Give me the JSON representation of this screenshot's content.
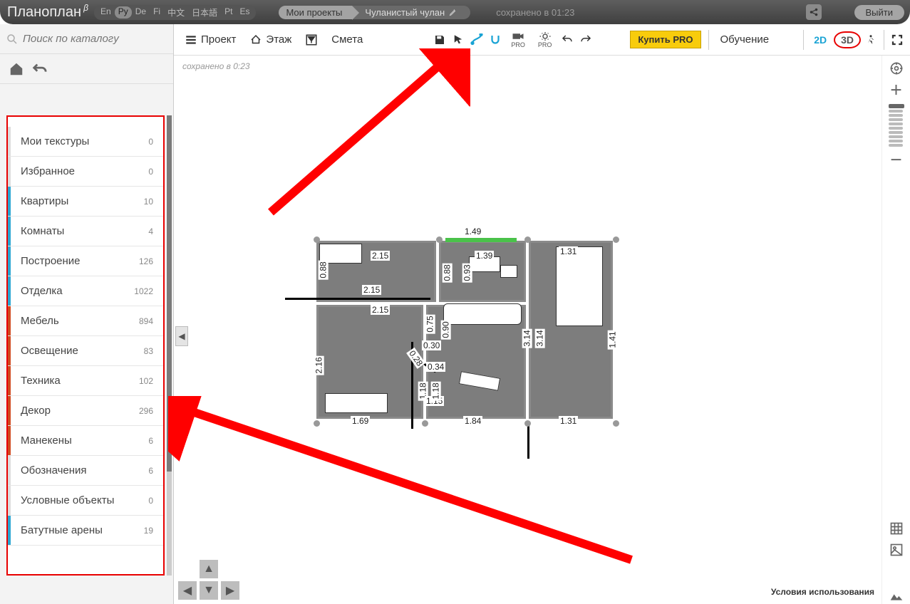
{
  "app": {
    "name": "Планоплан",
    "beta": "β"
  },
  "languages": [
    "En",
    "Ру",
    "De",
    "Fi",
    "中文",
    "日本語",
    "Pt",
    "Es"
  ],
  "active_lang_index": 1,
  "breadcrumb": {
    "my_projects": "Мои проекты",
    "project_name": "Чуланистый чулан"
  },
  "top_saved": "сохранено в 01:23",
  "exit": "Выйти",
  "toolbar2": {
    "project": "Проект",
    "floor": "Этаж",
    "estimate": "Смета",
    "pro1": "PRO",
    "pro2": "PRO",
    "buy_pro": "Купить PRO",
    "learn": "Обучение",
    "tab2d": "2D",
    "tab3d": "3D"
  },
  "search_placeholder": "Поиск по каталогу",
  "canvas_saved": "сохранено в 0:23",
  "categories": [
    {
      "label": "Мои текстуры",
      "count": 0,
      "bar": "#dcdcdc"
    },
    {
      "label": "Избранное",
      "count": 0,
      "bar": "#dcdcdc"
    },
    {
      "label": "Квартиры",
      "count": 10,
      "bar": "#2aa6d2"
    },
    {
      "label": "Комнаты",
      "count": 4,
      "bar": "#2aa6d2"
    },
    {
      "label": "Построение",
      "count": 126,
      "bar": "#2aa6d2"
    },
    {
      "label": "Отделка",
      "count": 1022,
      "bar": "#2aa6d2"
    },
    {
      "label": "Мебель",
      "count": 894,
      "bar": "#d1491e"
    },
    {
      "label": "Освещение",
      "count": 83,
      "bar": "#d1491e"
    },
    {
      "label": "Техника",
      "count": 102,
      "bar": "#d1491e"
    },
    {
      "label": "Декор",
      "count": 296,
      "bar": "#d1491e"
    },
    {
      "label": "Манекены",
      "count": 6,
      "bar": "#d1491e"
    },
    {
      "label": "Обозначения",
      "count": 6,
      "bar": "#dcdcdc"
    },
    {
      "label": "Условные объекты",
      "count": 0,
      "bar": "#dcdcdc"
    },
    {
      "label": "Батутные арены",
      "count": 19,
      "bar": "#2aa6d2"
    }
  ],
  "dimensions": {
    "top_1_49": "1.49",
    "l_2_15a": "2.15",
    "l_2_15b": "2.15",
    "l_2_15c": "2.15",
    "l_0_88": "0.88",
    "c_1_39": "1.39",
    "c_0_88": "0.88",
    "c_0_93": "0.93",
    "c_0_75": "0.75",
    "c_0_30": "0.30",
    "c_0_90": "0.90",
    "c_0_28": "0.28",
    "c_0_34": "0.34",
    "r_1_31top": "1.31",
    "r_3_14a": "3.14",
    "r_3_14b": "3.14",
    "r_1_41": "1.41",
    "l_2_16": "2.16",
    "b_1_69": "1.69",
    "b_1_18": "1.18",
    "b_1_15": "1.15",
    "b_1_18b": "1.18",
    "b_1_84": "1.84",
    "b_1_31": "1.31"
  },
  "terms": "Условия использования"
}
